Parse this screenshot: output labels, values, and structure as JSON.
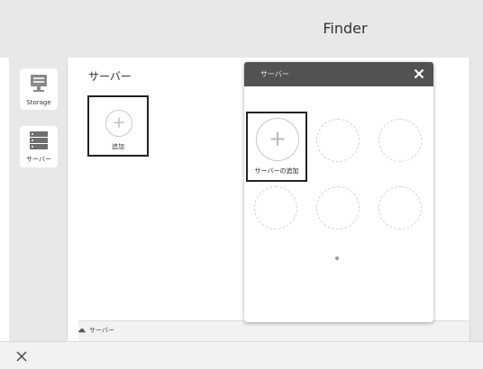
{
  "window": {
    "title": "Finder"
  },
  "sidebar": {
    "items": [
      {
        "label": "Storage",
        "icon": "storage-icon"
      },
      {
        "label": "サーバー",
        "icon": "server-rack-icon"
      }
    ]
  },
  "main": {
    "title": "サーバー",
    "add_tile_label": "追加"
  },
  "statusbar": {
    "label": "サーバー",
    "icon": "cloud-icon"
  },
  "bottombar": {
    "close_icon": "close-icon"
  },
  "dialog": {
    "title": "サーバー",
    "add_server_label": "サーバーの追加",
    "empty_slots": 5
  },
  "colors": {
    "chrome_gray": "#e8e8e8",
    "dialog_header": "#525252",
    "selection_border": "#222222"
  }
}
